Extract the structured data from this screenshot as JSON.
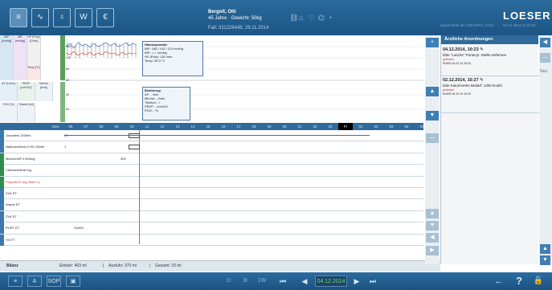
{
  "header": {
    "tools": [
      {
        "label": "≡",
        "icon": "chart-menu-icon"
      },
      {
        "label": "∿",
        "icon": "vitals-icon"
      },
      {
        "label": "♁",
        "icon": "cup-icon"
      },
      {
        "label": "W",
        "icon": "w-icon"
      },
      {
        "label": "€",
        "icon": "euro-icon"
      }
    ],
    "patient_name": "Bergolt, Otti",
    "patient_details": "45 Jahre · Gewicht: 50kg",
    "case": "Fall: 311226448, 29.11.2014",
    "logged_in": "angemeldet als: GRANITZ, [AN1]",
    "datetime": "04.12.2014 11:02:01",
    "logo": "LOESER"
  },
  "vitals_top": [
    {
      "label": "IBP [mmHg]",
      "color": "#d6e6f4"
    },
    {
      "label": "IBP [mmHg]",
      "color": "#efe2f4"
    },
    {
      "label": "HF (Puls) [1/min]",
      "color": "#f0f0f0"
    },
    {
      "label": "Temp [°C]",
      "color": "#fbe6e6"
    }
  ],
  "vitals_bottom": [
    {
      "label": "AF [1/min]",
      "color": "#e5eff8"
    },
    {
      "label": "PEEP [cmH2O]",
      "color": "#e7f3e9"
    },
    {
      "label": "MinVol [l/min]",
      "color": "#eef2f6"
    },
    {
      "label": "FiO2 [%]",
      "color": "#eef2f6"
    },
    {
      "label": "Tidalvol [ml]",
      "color": "#eef2f6"
    }
  ],
  "y_scale": [
    "160",
    "120",
    "80",
    "40",
    "40",
    "20"
  ],
  "hemo_box": [
    "Hämodynamik:",
    "IBP: 185 / 142 / 110 mmHg",
    "IBP: -/-/- mmHg",
    "HF (Puls): 118 /min",
    "Temp: 39.3 °C"
  ],
  "vent_box": [
    "Beatmung:",
    "AF: - /min",
    "MinVol: - l/min",
    "Tidalvol: - l",
    "PEEP: - cmH2O",
    "FiO2: - %"
  ],
  "hours": [
    "Now",
    "06",
    "07",
    "08",
    "09",
    "10",
    "11",
    "12",
    "13",
    "14",
    "15",
    "16",
    "17",
    "18",
    "19",
    "20",
    "21",
    "22",
    "23",
    "Fr",
    "01",
    "02",
    "03",
    "04",
    "05"
  ],
  "current_hour": "Fr",
  "rows": [
    {
      "label": "Jonosteril 1000ml",
      "tag": "b",
      "val": "20"
    },
    {
      "label": "Natriumchlorid 0.9% 250ml",
      "tag": "b",
      "val": "1"
    },
    {
      "label": "Meronem® 0.500mg",
      "tag": "g",
      "val": "500"
    },
    {
      "label": "Calciumfolinat mg",
      "tag": "g",
      "val": ""
    },
    {
      "label": "Propofol Fr mg 20ml/ Lu",
      "tag": "g",
      "val": ""
    },
    {
      "label": "ZVK ET",
      "tag": "b",
      "val": ""
    },
    {
      "label": "Arterie ET",
      "tag": "b",
      "val": ""
    },
    {
      "label": "ZVK ET",
      "tag": "b",
      "val": ""
    },
    {
      "label": "PORT ET",
      "tag": "b",
      "val": "SUMO"
    },
    {
      "label": "TK ET",
      "tag": "b",
      "val": ""
    }
  ],
  "bilanz": {
    "label": "Bilanz",
    "in": "Einfuhr: 403 ml",
    "out": "Ausfuhr: 370 ml",
    "total": "Gesamt: 33 ml"
  },
  "orders_title": "Ärztliche Anordnungen",
  "orders": [
    {
      "date": "04.12.2014, 10:23",
      "text": "bitte \"Lasche\" Portacyl.-Stelle entfernen",
      "status": "geändert",
      "by": "SUMO 04.12.14 10:23"
    },
    {
      "date": "02.12.2014, 16:27",
      "text": "bitte Kalorimetrie Bedarf: 1300 kcal/d",
      "status": "geändert",
      "by": "SUMO 04.12.14 10:23"
    }
  ],
  "right_rail": {
    "plus": "+",
    "new": "Neu"
  },
  "footer": {
    "left": [
      {
        "label": "≡",
        "icon": "list-icon"
      },
      {
        "label": "A",
        "icon": "a-icon"
      },
      {
        "label": "SOP",
        "icon": "sop-icon"
      },
      {
        "label": "▣",
        "icon": "box-icon"
      }
    ],
    "ranges": [
      "1t",
      "3t",
      "1W"
    ],
    "date": "04.12.2014",
    "help": "?",
    "back": "←",
    "lock": "🔒"
  }
}
